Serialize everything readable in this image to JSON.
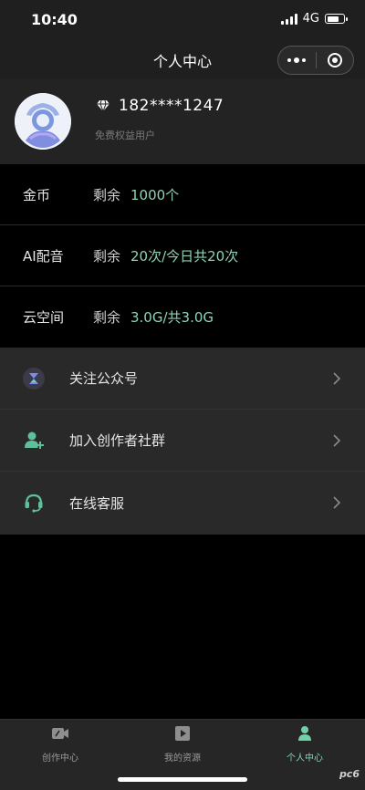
{
  "status_bar": {
    "time": "10:40",
    "network": "4G",
    "signal_bars": 4,
    "battery_level": 0.8
  },
  "nav": {
    "title": "个人中心",
    "more_icon": "more-dots-icon",
    "close_icon": "target-icon"
  },
  "profile": {
    "phone": "182****1247",
    "subtitle": "免费权益用户",
    "badge_icon": "diamond-icon"
  },
  "quotas": [
    {
      "label": "金币",
      "prefix": "剩余",
      "value": "1000个"
    },
    {
      "label": "AI配音",
      "prefix": "剩余",
      "value": "20次/今日共20次"
    },
    {
      "label": "云空间",
      "prefix": "剩余",
      "value": "3.0G/共3.0G"
    }
  ],
  "menu": [
    {
      "label": "关注公众号",
      "icon": "hourglass-icon"
    },
    {
      "label": "加入创作者社群",
      "icon": "add-user-icon"
    },
    {
      "label": "在线客服",
      "icon": "headset-icon"
    }
  ],
  "tabs": [
    {
      "label": "创作中心",
      "icon": "video-edit-icon",
      "active": false
    },
    {
      "label": "我的资源",
      "icon": "play-folder-icon",
      "active": false
    },
    {
      "label": "个人中心",
      "icon": "person-icon",
      "active": true
    }
  ],
  "watermark": "pc6",
  "colors": {
    "accent": "#8fd2b6",
    "tab_active": "#7fd6b3",
    "background": "#000000"
  }
}
